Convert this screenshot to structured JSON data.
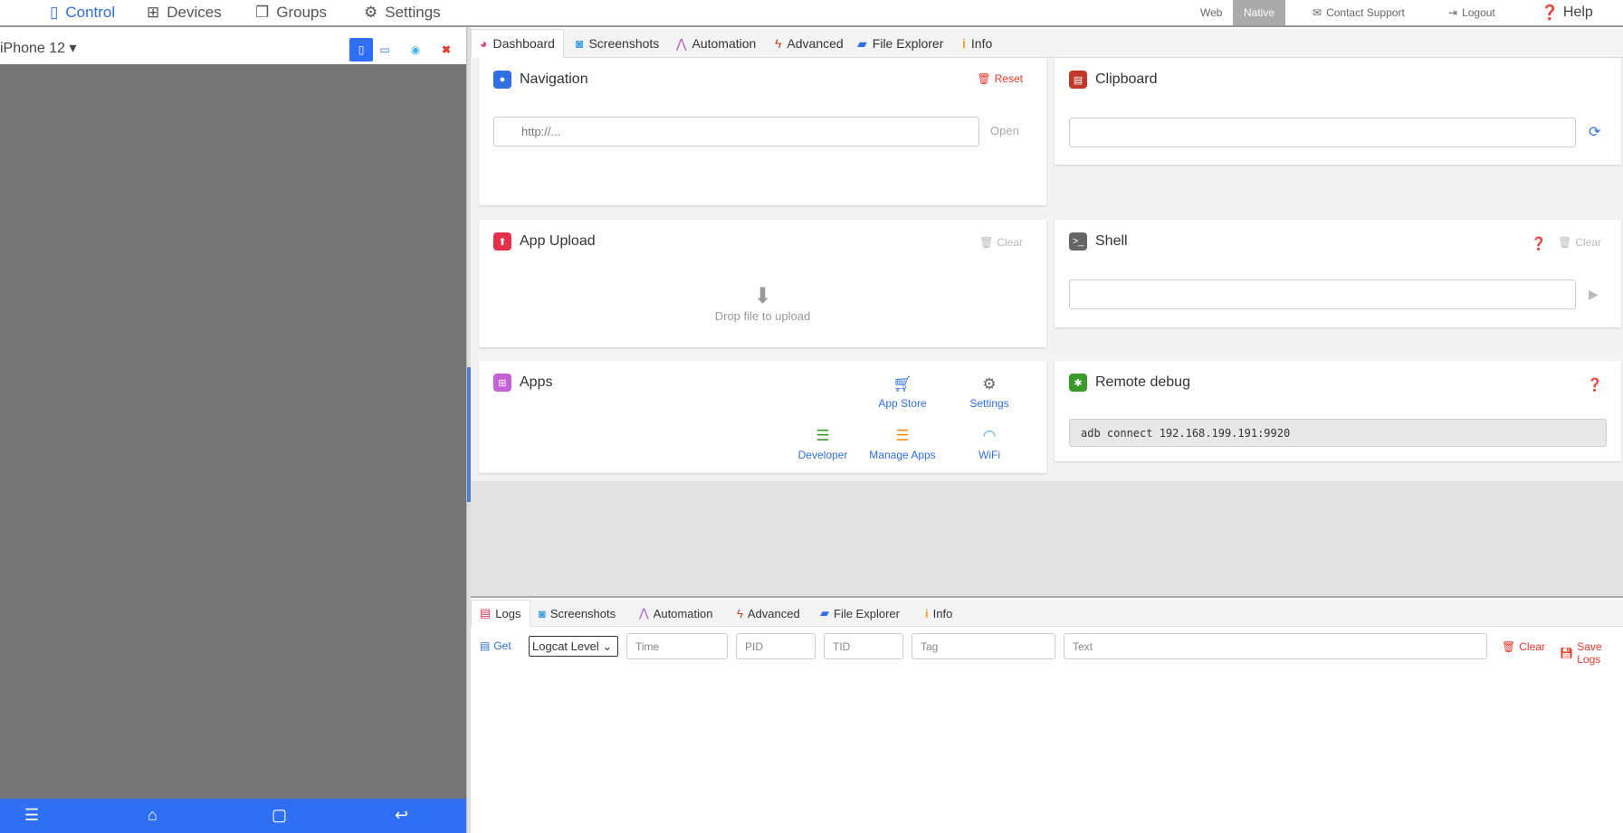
{
  "topnav": {
    "items": [
      {
        "label": "Control",
        "icon": "mobile-icon"
      },
      {
        "label": "Devices",
        "icon": "sitemap-icon"
      },
      {
        "label": "Groups",
        "icon": "clone-icon"
      },
      {
        "label": "Settings",
        "icon": "cogs-icon"
      }
    ],
    "right": {
      "web": "Web",
      "native": "Native",
      "contact": "Contact Support",
      "logout": "Logout",
      "help": "Help"
    }
  },
  "device": {
    "name": "iPhone 12"
  },
  "tabs": [
    "Dashboard",
    "Screenshots",
    "Automation",
    "Advanced",
    "File Explorer",
    "Info"
  ],
  "navigation": {
    "title": "Navigation",
    "reset": "Reset",
    "placeholder": "http://...",
    "open": "Open"
  },
  "clipboard": {
    "title": "Clipboard",
    "value": ""
  },
  "upload": {
    "title": "App Upload",
    "clear": "Clear",
    "drop": "Drop file to upload"
  },
  "shell": {
    "title": "Shell",
    "clear": "Clear",
    "value": ""
  },
  "apps": {
    "title": "Apps",
    "buttons": [
      "App Store",
      "Settings",
      "Developer",
      "Manage Apps",
      "WiFi"
    ]
  },
  "remote": {
    "title": "Remote debug",
    "command": "adb connect 192.168.199.191:9920"
  },
  "logs": {
    "tabs": [
      "Logs",
      "Screenshots",
      "Automation",
      "Advanced",
      "File Explorer",
      "Info"
    ],
    "get": "Get",
    "level": "Logcat Level",
    "time": "Time",
    "pid": "PID",
    "tid": "TID",
    "tag": "Tag",
    "text": "Text",
    "clear": "Clear",
    "save": "Save Logs"
  },
  "colors": {
    "accent": "#2f6fe0",
    "danger": "#e8392b"
  }
}
